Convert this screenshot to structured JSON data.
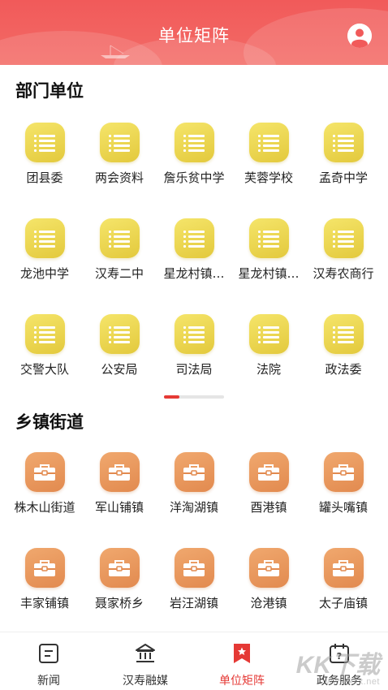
{
  "header": {
    "title": "单位矩阵"
  },
  "sections": [
    {
      "title": "部门单位",
      "icon": "document-list-icon",
      "color": "#e9d24c",
      "items": [
        "团县委",
        "两会资料",
        "詹乐贫中学",
        "芙蓉学校",
        "孟奇中学",
        "龙池中学",
        "汉寿二中",
        "星龙村镇…",
        "星龙村镇…",
        "汉寿农商行",
        "交警大队",
        "公安局",
        "司法局",
        "法院",
        "政法委"
      ]
    },
    {
      "title": "乡镇街道",
      "icon": "briefcase-icon",
      "color": "#e6935a",
      "items": [
        "株木山街道",
        "军山铺镇",
        "洋淘湖镇",
        "酉港镇",
        "罐头嘴镇",
        "丰家铺镇",
        "聂家桥乡",
        "岩汪湖镇",
        "沧港镇",
        "太子庙镇"
      ]
    }
  ],
  "pager": {
    "pages": 4,
    "active": 1
  },
  "bottom_nav": [
    {
      "label": "新闻",
      "icon": "news-icon",
      "active": false
    },
    {
      "label": "汉寿融媒",
      "icon": "bank-icon",
      "active": false
    },
    {
      "label": "单位矩阵",
      "icon": "bookmark-star-icon",
      "active": true
    },
    {
      "label": "政务服务",
      "icon": "calendar-question-icon",
      "active": false
    }
  ],
  "watermark": {
    "text": "KK下载",
    "url": "www.kkx.net"
  },
  "colors": {
    "accent": "#e53935",
    "header": "#f15a5a"
  }
}
